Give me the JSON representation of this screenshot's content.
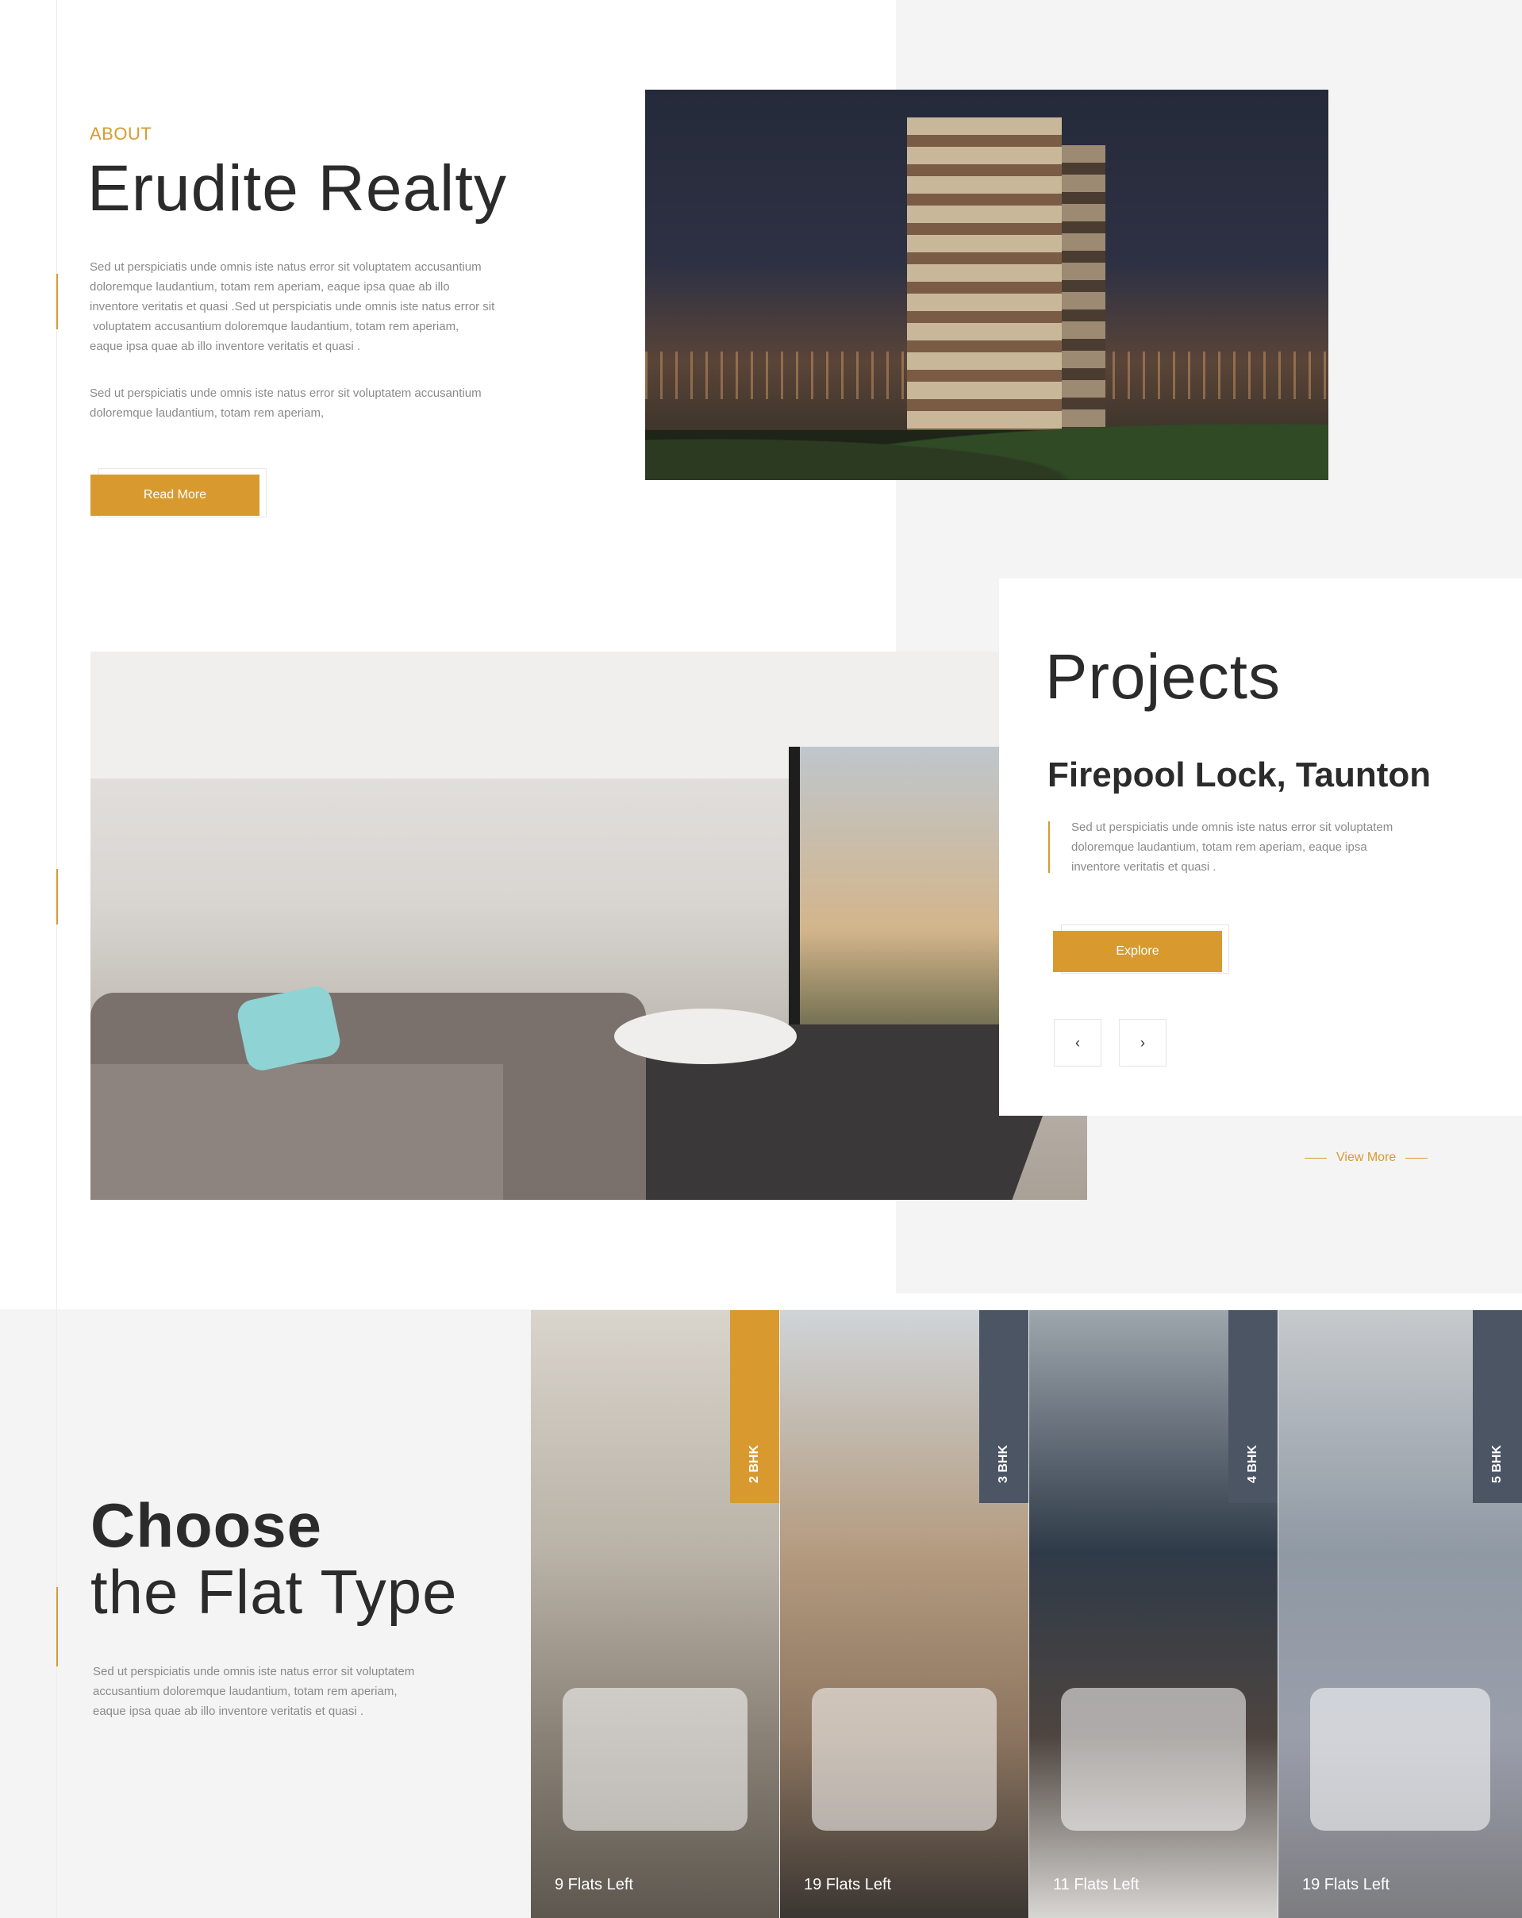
{
  "colors": {
    "accent": "#d89a2f",
    "slate": "#4b5563",
    "panel_bg": "#f4f4f4"
  },
  "about": {
    "eyebrow": "ABOUT",
    "title": "Erudite Realty",
    "para1_lines": [
      "Sed ut perspiciatis unde omnis iste natus error sit voluptatem accusantium",
      "doloremque laudantium, totam rem aperiam, eaque ipsa quae ab illo",
      "inventore veritatis et quasi .Sed ut perspiciatis unde omnis iste natus error sit",
      " voluptatem accusantium doloremque laudantium, totam rem aperiam,",
      "eaque ipsa quae ab illo inventore veritatis et quasi ."
    ],
    "para2_lines": [
      "Sed ut perspiciatis unde omnis iste natus error sit voluptatem accusantium",
      "doloremque laudantium, totam rem aperiam,"
    ],
    "button": "Read More"
  },
  "projects": {
    "title": "Projects",
    "subtitle": "Firepool Lock, Taunton",
    "para_lines": [
      "Sed ut perspiciatis unde omnis iste natus error sit voluptatem",
      "doloremque laudantium, totam rem aperiam, eaque ipsa",
      "inventore veritatis et quasi ."
    ],
    "button": "Explore",
    "prev_icon": "‹",
    "next_icon": "›",
    "view_more": "View More"
  },
  "flat_types": {
    "title_bold": "Choose",
    "title_light": "the Flat Type",
    "para_lines": [
      "Sed ut perspiciatis unde omnis iste natus error sit voluptatem",
      "accusantium doloremque laudantium, totam rem aperiam,",
      "eaque ipsa quae ab illo inventore veritatis et quasi ."
    ],
    "cards": [
      {
        "tag": "2 BHK",
        "label": "9 Flats Left",
        "tag_color": "#d89a2f"
      },
      {
        "tag": "3 BHK",
        "label": "19 Flats Left",
        "tag_color": "#4b5563"
      },
      {
        "tag": "4 BHK",
        "label": "11 Flats Left",
        "tag_color": "#4b5563"
      },
      {
        "tag": "5 BHK",
        "label": "19 Flats Left",
        "tag_color": "#4b5563"
      }
    ]
  }
}
